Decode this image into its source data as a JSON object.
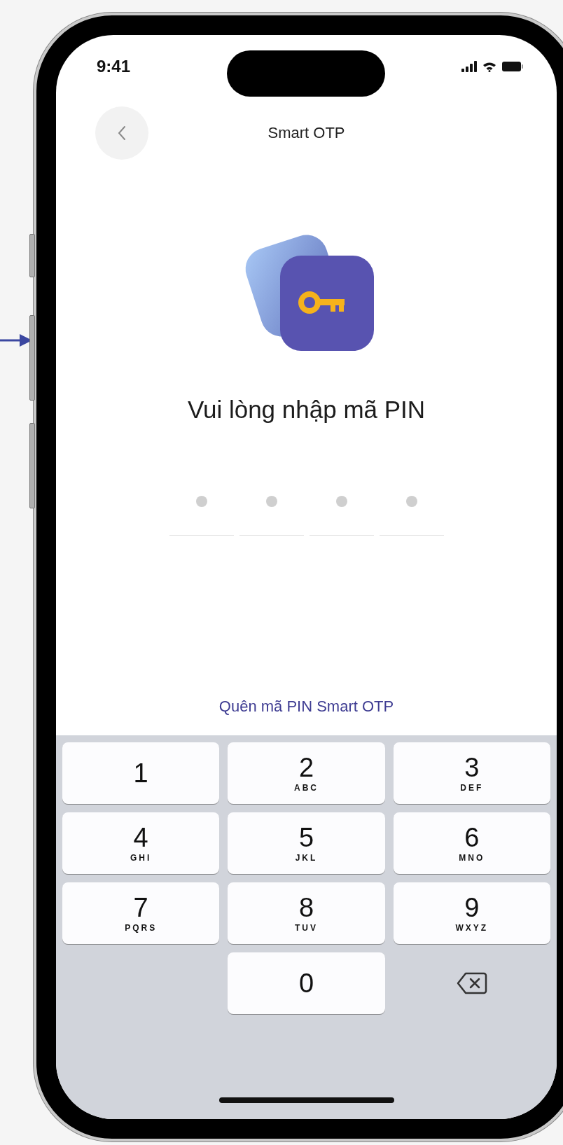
{
  "status_bar": {
    "time": "9:41"
  },
  "header": {
    "title": "Smart OTP"
  },
  "heading": "Vui lòng nhập mã PIN",
  "pin_slots": [
    {
      "filled": false
    },
    {
      "filled": false
    },
    {
      "filled": false
    },
    {
      "filled": false
    }
  ],
  "forgot_link": "Quên mã PIN Smart OTP",
  "keypad": [
    {
      "kind": "digit",
      "digit": "1"
    },
    {
      "kind": "digit",
      "digit": "2",
      "letters": "ABC"
    },
    {
      "kind": "digit",
      "digit": "3",
      "letters": "DEF"
    },
    {
      "kind": "digit",
      "digit": "4",
      "letters": "GHI"
    },
    {
      "kind": "digit",
      "digit": "5",
      "letters": "JKL"
    },
    {
      "kind": "digit",
      "digit": "6",
      "letters": "MNO"
    },
    {
      "kind": "digit",
      "digit": "7",
      "letters": "PQRS"
    },
    {
      "kind": "digit",
      "digit": "8",
      "letters": "TUV"
    },
    {
      "kind": "digit",
      "digit": "9",
      "letters": "WXYZ"
    },
    {
      "kind": "blank"
    },
    {
      "kind": "digit",
      "digit": "0"
    },
    {
      "kind": "delete"
    }
  ]
}
